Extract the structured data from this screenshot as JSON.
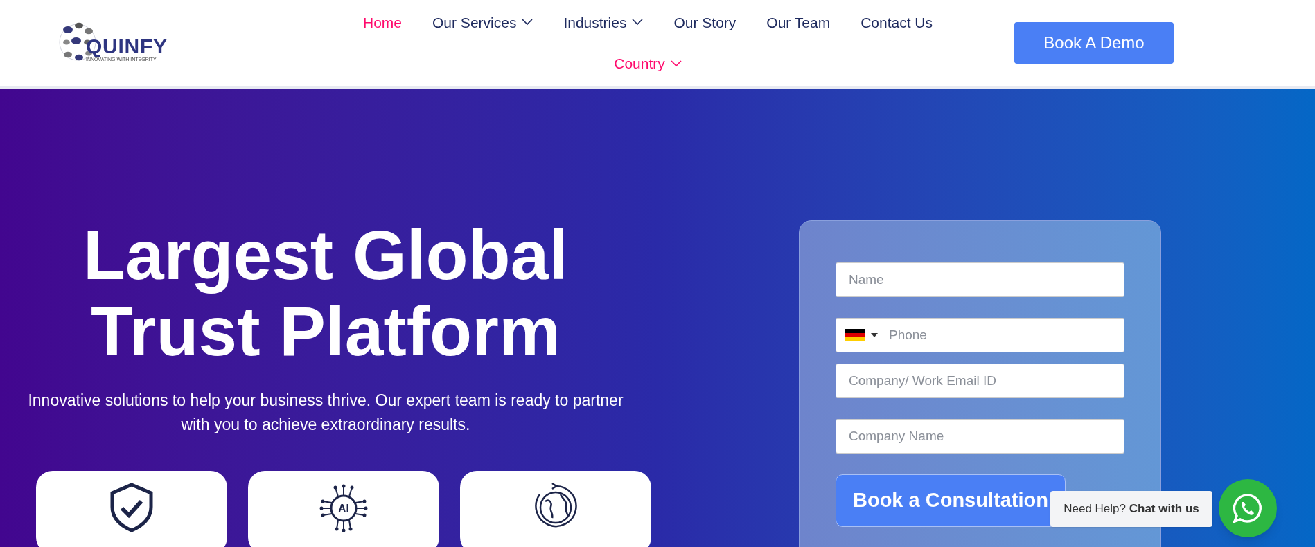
{
  "logo": {
    "name": "QUINFY",
    "tagline": "INNOVATING WITH INTEGRITY"
  },
  "nav": [
    {
      "label": "Home",
      "selected": true,
      "dropdown": false
    },
    {
      "label": "Our Services",
      "selected": false,
      "dropdown": true
    },
    {
      "label": "Industries",
      "selected": false,
      "dropdown": true
    },
    {
      "label": "Our Story",
      "selected": false,
      "dropdown": false
    },
    {
      "label": "Our Team",
      "selected": false,
      "dropdown": false
    },
    {
      "label": "Contact Us",
      "selected": false,
      "dropdown": false
    }
  ],
  "nav_row2": [
    {
      "label": "Country",
      "selected": true,
      "dropdown": true
    }
  ],
  "demo_button": "Book A Demo",
  "hero": {
    "title_lines": [
      "Largest Global",
      "Trust Platform"
    ],
    "subtitle": "Innovative solutions to help your business thrive. Our expert team is ready to partner with you to achieve extraordinary results."
  },
  "cards": [
    {
      "kind": "shield"
    },
    {
      "kind": "ai",
      "icon_text": "AI"
    },
    {
      "kind": "globe"
    }
  ],
  "form": {
    "fields": [
      {
        "kind": "text",
        "placeholder": "Name"
      },
      {
        "kind": "phone",
        "placeholder": "Phone"
      },
      {
        "kind": "text",
        "placeholder": "Company/ Work Email ID"
      },
      {
        "kind": "text",
        "placeholder": "Company Name"
      }
    ],
    "submit": "Book a Consultation"
  },
  "chat": {
    "prefix": "Need Help?",
    "action": "Chat with us"
  }
}
